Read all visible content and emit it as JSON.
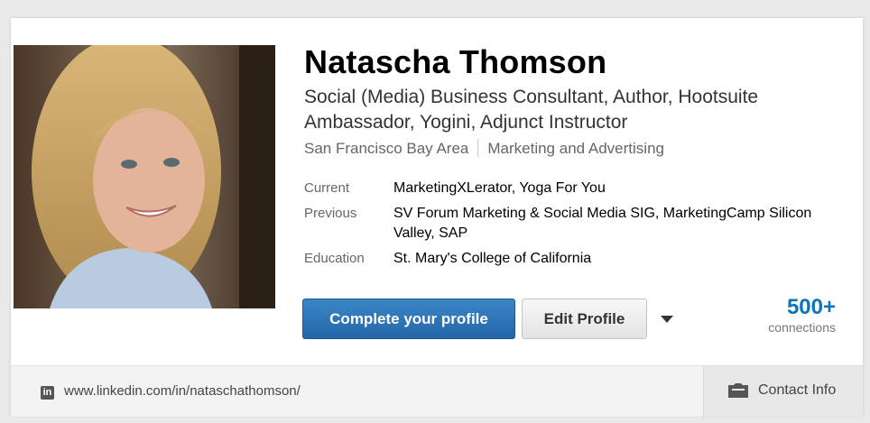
{
  "profile": {
    "name": "Natascha Thomson",
    "headline": "Social (Media) Business Consultant, Author, Hootsuite Ambassador, Yogini, Adjunct Instructor",
    "location": "San Francisco Bay Area",
    "industry": "Marketing and Advertising"
  },
  "details": [
    {
      "label": "Current",
      "value": "MarketingXLerator, Yoga For You"
    },
    {
      "label": "Previous",
      "value": "SV Forum Marketing & Social Media SIG, MarketingCamp Silicon Valley, SAP"
    },
    {
      "label": "Education",
      "value": "St. Mary's College of California"
    }
  ],
  "actions": {
    "complete_profile": "Complete your profile",
    "edit_profile": "Edit Profile",
    "dropdown_icon": "chevron-down-icon"
  },
  "connections": {
    "count": "500+",
    "label": "connections"
  },
  "footer": {
    "linkedin_icon_text": "in",
    "url": "www.linkedin.com/in/nataschathomson/",
    "contact_label": "Contact Info",
    "contact_icon": "contact-card-icon"
  },
  "colors": {
    "primary_button": "#2b6fb0",
    "connections_count": "#0b75b7"
  }
}
